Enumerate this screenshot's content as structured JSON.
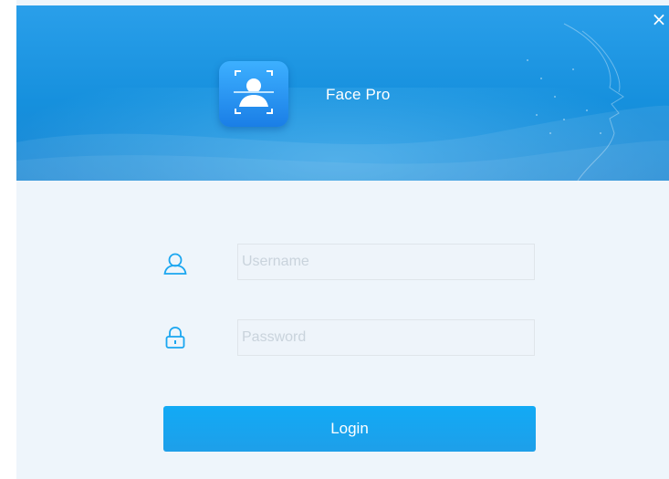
{
  "window": {
    "close_glyph": "×",
    "app_title": "Face Pro",
    "logo_icon": "face-scan-icon"
  },
  "login_form": {
    "username": {
      "value": "",
      "placeholder": "Username",
      "icon": "user-icon"
    },
    "password": {
      "value": "",
      "placeholder": "Password",
      "icon": "lock-icon"
    },
    "login_label": "Login"
  },
  "colors": {
    "header_blue": "#1a90dd",
    "accent": "#1aa6f0",
    "form_background": "#eef5fb",
    "icon_blue": "#1aa6f0"
  }
}
